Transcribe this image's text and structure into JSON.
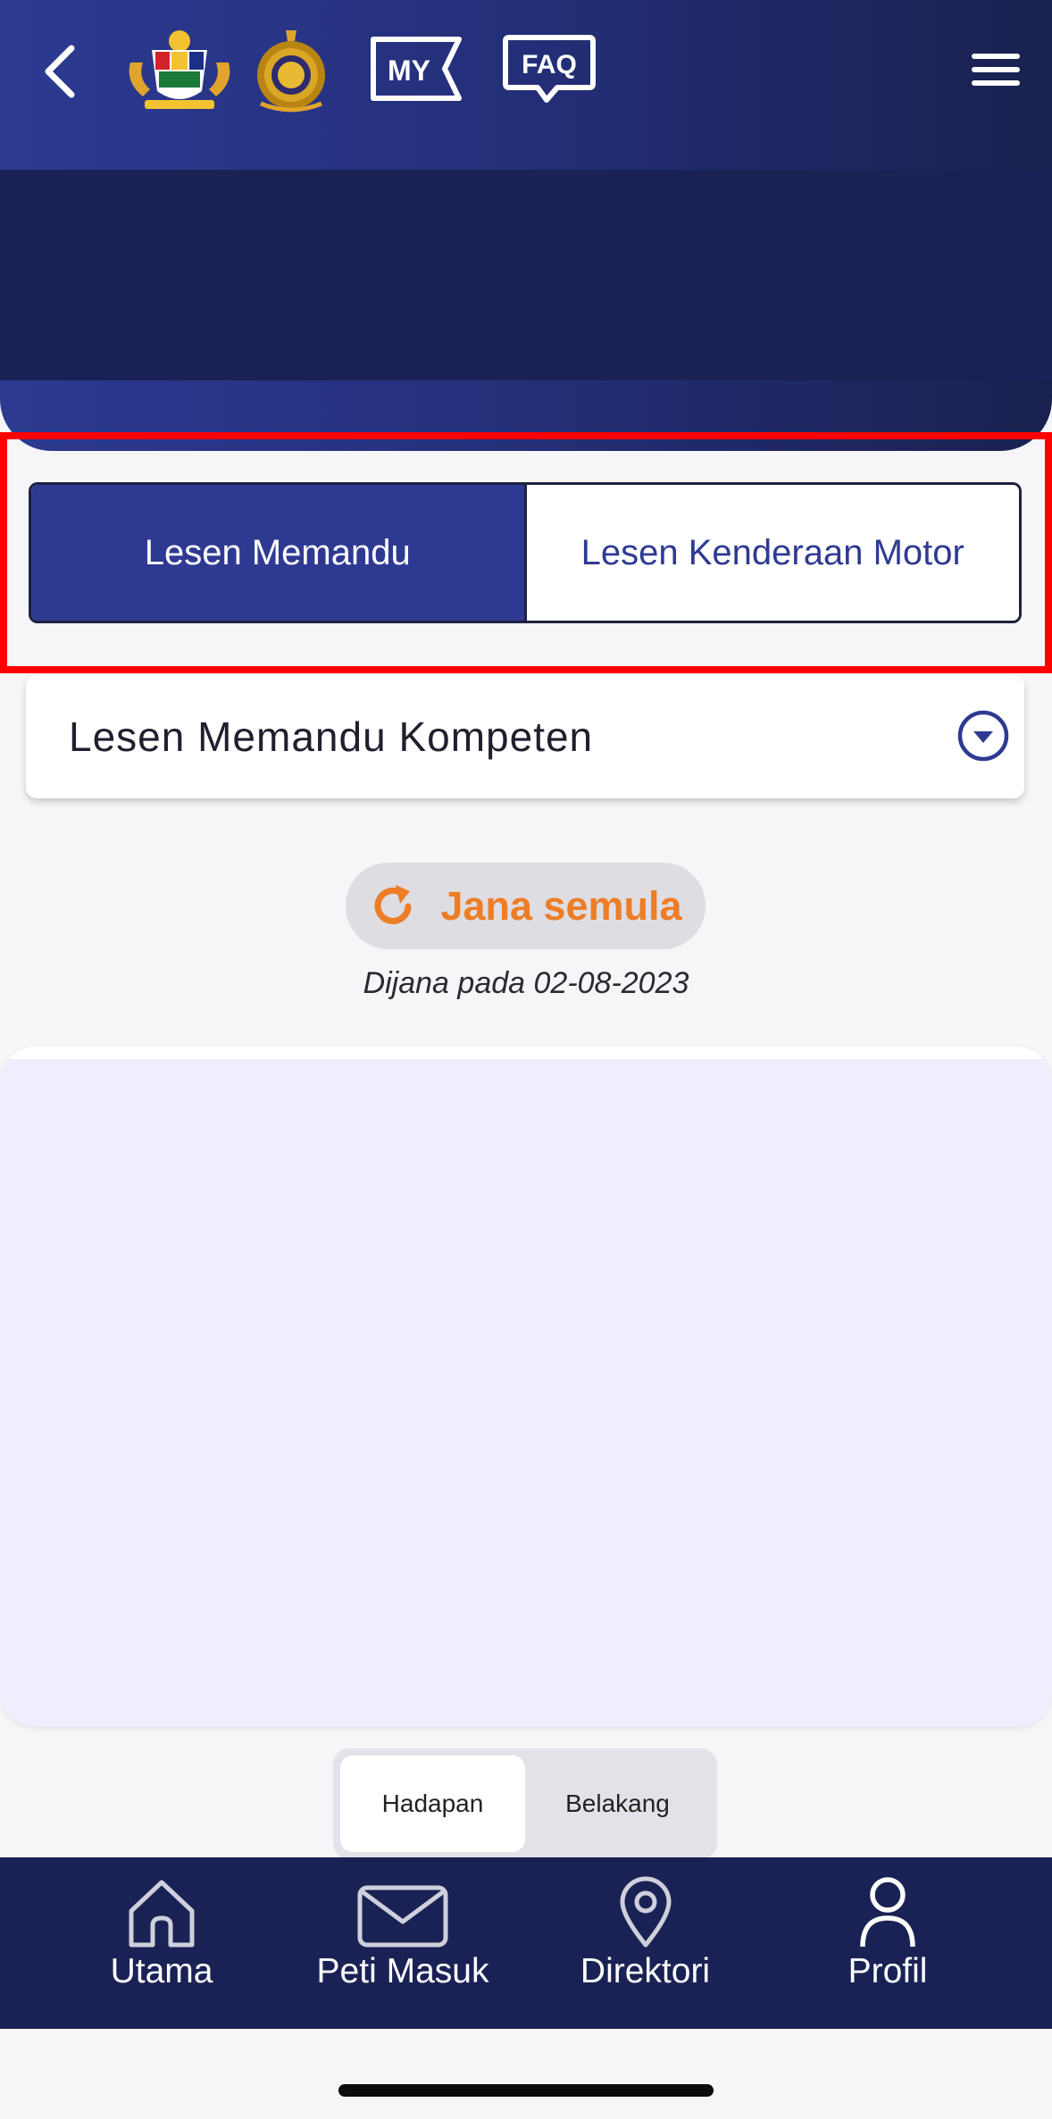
{
  "header": {
    "my_badge": "MY",
    "faq_badge": "FAQ",
    "icons": [
      "back-arrow-icon",
      "malaysia-crest-logo",
      "jpj-logo",
      "my-badge-icon",
      "faq-bubble-icon",
      "hamburger-menu-icon"
    ]
  },
  "license_tabs": {
    "tab1": "Lesen Memandu",
    "tab2": "Lesen Kenderaan Motor",
    "active": "Lesen Memandu"
  },
  "license_select": {
    "value": "Lesen Memandu Kompeten"
  },
  "regenerate": {
    "label": "Jana semula",
    "generated_text": "Dijana pada 02-08-2023"
  },
  "card_side": {
    "front": "Hadapan",
    "back": "Belakang",
    "active": "Hadapan"
  },
  "bottom_nav": {
    "items": [
      {
        "label": "Utama",
        "icon": "home-icon"
      },
      {
        "label": "Peti Masuk",
        "icon": "mail-icon"
      },
      {
        "label": "Direktori",
        "icon": "location-pin-icon"
      },
      {
        "label": "Profil",
        "icon": "user-icon"
      }
    ]
  },
  "colors": {
    "primary": "#2e3a92",
    "navy": "#1a2255",
    "accent_orange": "#ed7d26",
    "highlight_frame": "#ff0000",
    "card_bg": "#f0eefe"
  }
}
